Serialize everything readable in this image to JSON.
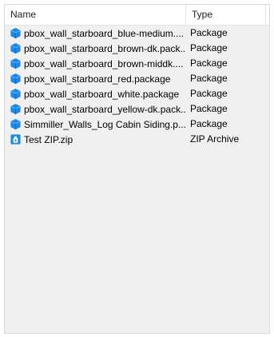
{
  "columns": {
    "name": "Name",
    "type": "Type"
  },
  "files": [
    {
      "name": "pbox_wall_starboard_blue-medium....",
      "type": "Package",
      "icon": "package-icon"
    },
    {
      "name": "pbox_wall_starboard_brown-dk.pack...",
      "type": "Package",
      "icon": "package-icon"
    },
    {
      "name": "pbox_wall_starboard_brown-middk....",
      "type": "Package",
      "icon": "package-icon"
    },
    {
      "name": "pbox_wall_starboard_red.package",
      "type": "Package",
      "icon": "package-icon"
    },
    {
      "name": "pbox_wall_starboard_white.package",
      "type": "Package",
      "icon": "package-icon"
    },
    {
      "name": "pbox_wall_starboard_yellow-dk.pack...",
      "type": "Package",
      "icon": "package-icon"
    },
    {
      "name": "Simmiller_Walls_Log Cabin Siding.p...",
      "type": "Package",
      "icon": "package-icon"
    },
    {
      "name": "Test ZIP.zip",
      "type": "ZIP Archive",
      "icon": "zip-archive-icon"
    }
  ],
  "colors": {
    "package_icon": "#1e88e5",
    "zip_icon": "#1a8fd6"
  }
}
